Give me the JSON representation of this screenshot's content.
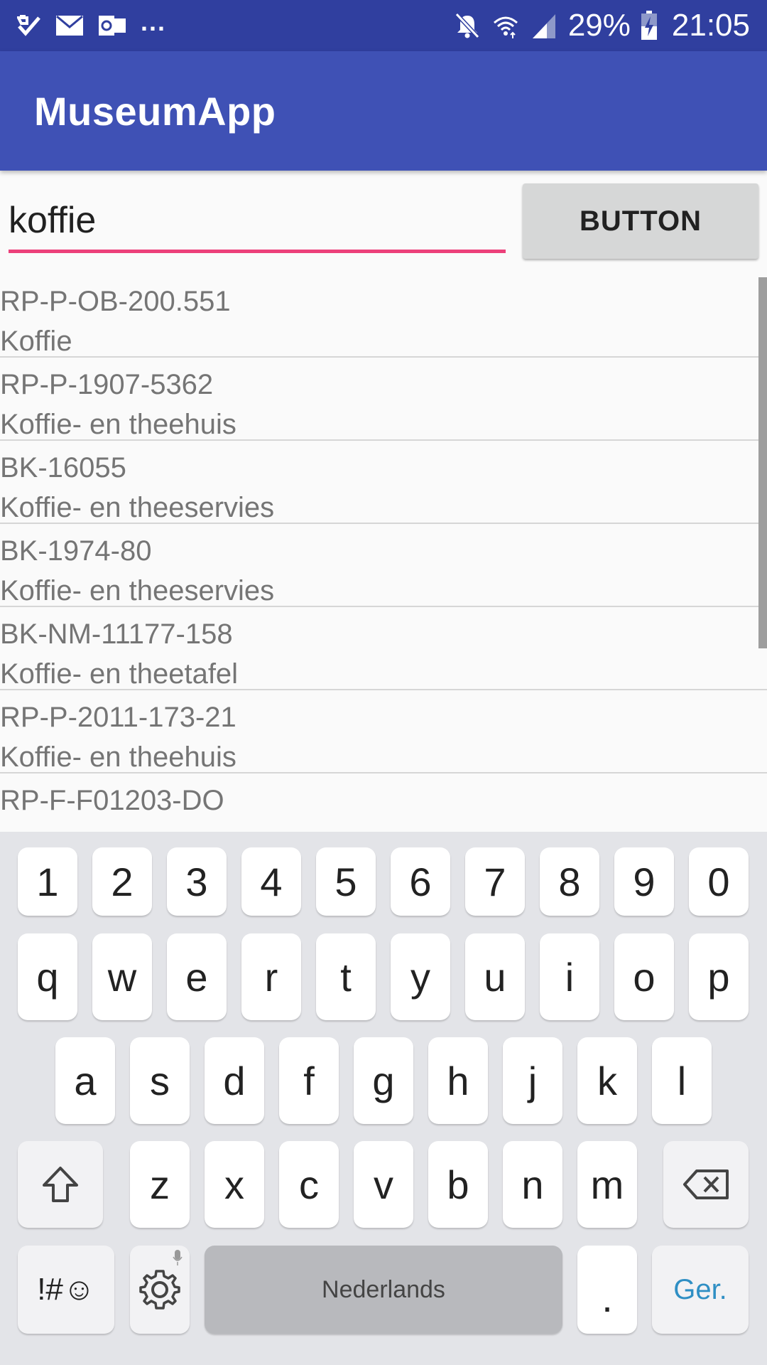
{
  "status_bar": {
    "left_icons": [
      "checkmark-notification-icon",
      "mail-icon",
      "outlook-icon"
    ],
    "more_indicator": "...",
    "battery_percent": "29%",
    "time": "21:05",
    "right_icons": [
      "mute-icon",
      "wifi-icon",
      "signal-icon",
      "battery-charging-icon"
    ]
  },
  "app_bar": {
    "title": "MuseumApp",
    "color": "#3f51b5"
  },
  "search": {
    "value": "koffie",
    "underline_color": "#ec407a"
  },
  "action_button": {
    "label": "BUTTON"
  },
  "results": [
    {
      "id": "RP-P-OB-200.551",
      "title": "Koffie"
    },
    {
      "id": "RP-P-1907-5362",
      "title": "Koffie- en theehuis"
    },
    {
      "id": "BK-16055",
      "title": "Koffie- en theeservies"
    },
    {
      "id": "BK-1974-80",
      "title": "Koffie- en theeservies"
    },
    {
      "id": "BK-NM-11177-158",
      "title": "Koffie- en theetafel"
    },
    {
      "id": "RP-P-2011-173-21",
      "title": "Koffie- en theehuis"
    },
    {
      "id": "RP-F-F01203-DO",
      "title": ""
    }
  ],
  "keyboard": {
    "number_row": [
      "1",
      "2",
      "3",
      "4",
      "5",
      "6",
      "7",
      "8",
      "9",
      "0"
    ],
    "row1": [
      "q",
      "w",
      "e",
      "r",
      "t",
      "y",
      "u",
      "i",
      "o",
      "p"
    ],
    "row2": [
      "a",
      "s",
      "d",
      "f",
      "g",
      "h",
      "j",
      "k",
      "l"
    ],
    "row3": [
      "z",
      "x",
      "c",
      "v",
      "b",
      "n",
      "m"
    ],
    "symbols_key": "!#☺",
    "space_label": "Nederlands",
    "period_key": ".",
    "enter_label": "Ger."
  }
}
